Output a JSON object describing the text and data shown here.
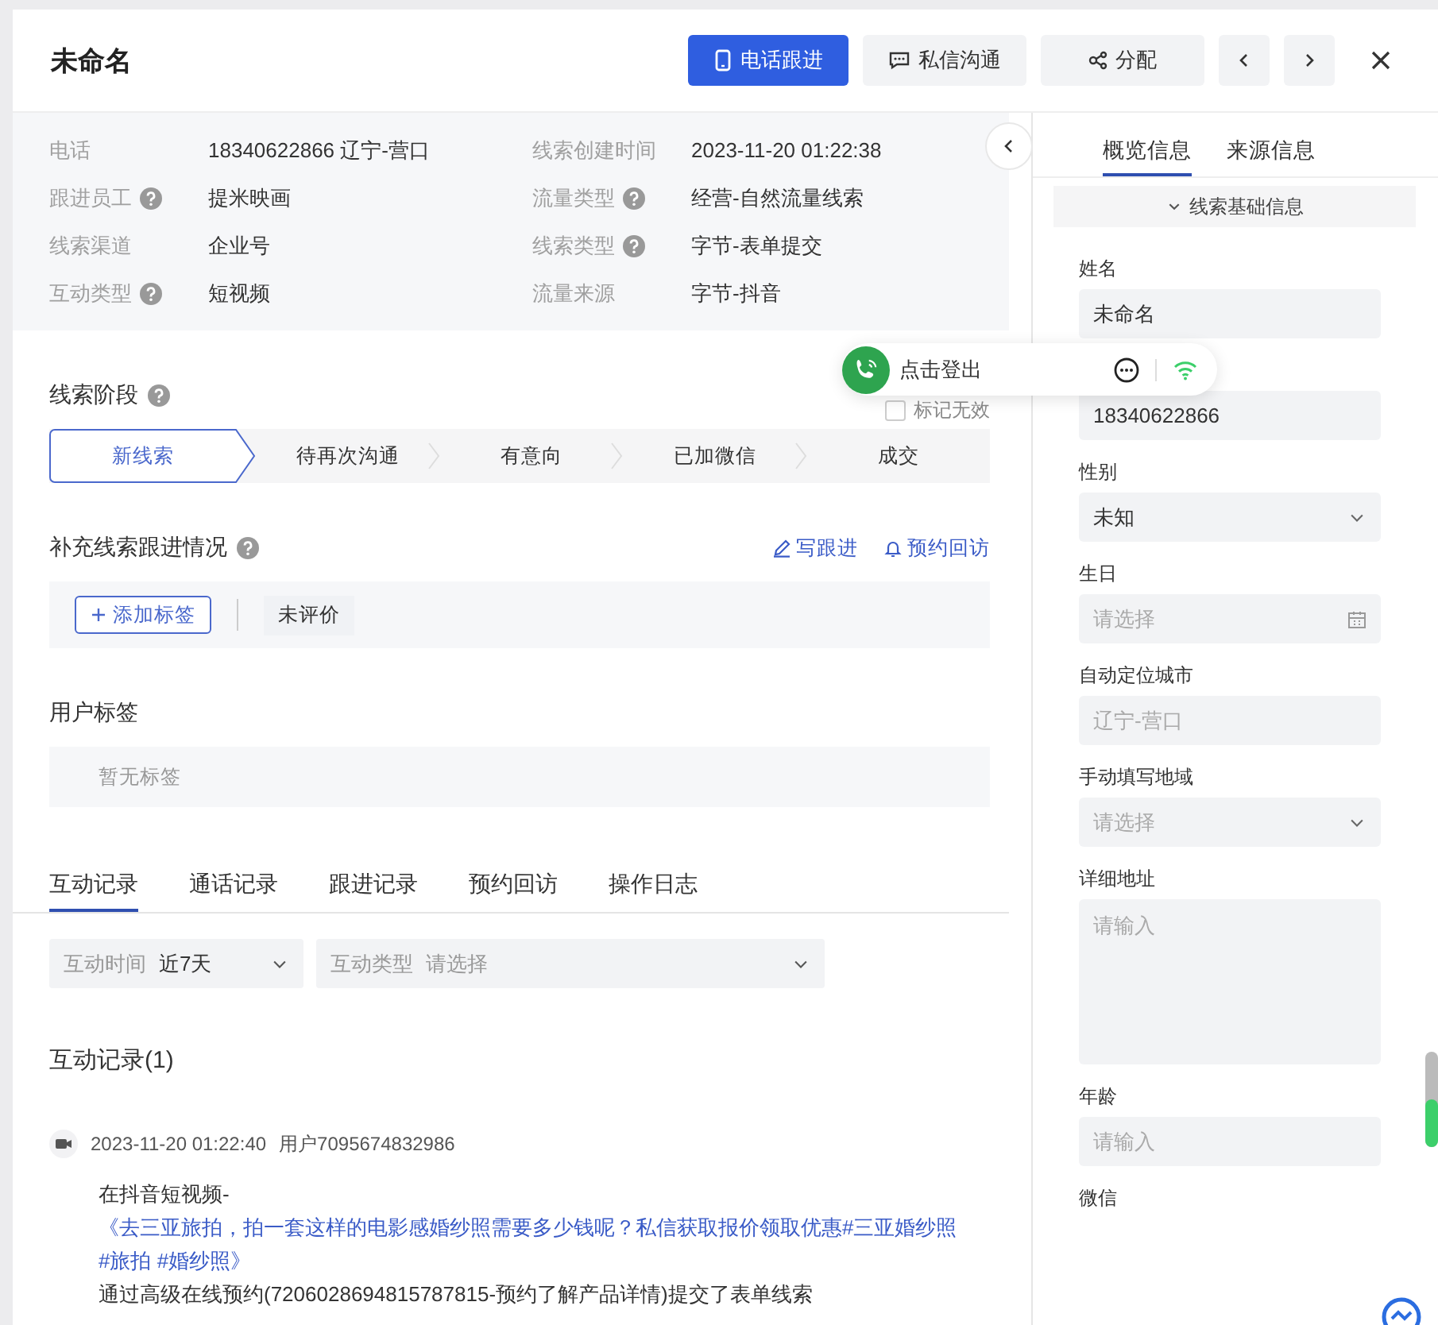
{
  "header": {
    "title": "未命名",
    "buttons": [
      {
        "label": "电话跟进",
        "kind": "call"
      },
      {
        "label": "私信沟通",
        "kind": "chat"
      },
      {
        "label": "分配",
        "kind": "assign"
      }
    ]
  },
  "info": [
    {
      "label": "电话",
      "help": false,
      "value": "18340622866 辽宁-营口"
    },
    {
      "label": "线索创建时间",
      "help": false,
      "value": "2023-11-20 01:22:38"
    },
    {
      "label": "跟进员工",
      "help": true,
      "value": "提米映画"
    },
    {
      "label": "流量类型",
      "help": true,
      "value": "经营-自然流量线索"
    },
    {
      "label": "线索渠道",
      "help": false,
      "value": "企业号"
    },
    {
      "label": "线索类型",
      "help": true,
      "value": "字节-表单提交"
    },
    {
      "label": "互动类型",
      "help": true,
      "value": "短视频"
    },
    {
      "label": "流量来源",
      "help": false,
      "value": "字节-抖音"
    }
  ],
  "stage": {
    "title": "线索阶段",
    "help": true,
    "mark_invalid": {
      "label": "标记无效",
      "checked": false
    },
    "steps": [
      {
        "label": "新线索",
        "selected": true
      },
      {
        "label": "待再次沟通",
        "selected": false
      },
      {
        "label": "有意向",
        "selected": false
      },
      {
        "label": "已加微信",
        "selected": false
      },
      {
        "label": "成交",
        "selected": false
      }
    ]
  },
  "followup": {
    "title": "补充线索跟进情况",
    "help": true,
    "actions": [
      {
        "label": "写跟进",
        "kind": "write"
      },
      {
        "label": "预约回访",
        "kind": "remind"
      }
    ],
    "add_tag": "添加标签",
    "rating": "未评价"
  },
  "user_tags": {
    "title": "用户标签",
    "empty": "暂无标签"
  },
  "record_tabs": [
    {
      "label": "互动记录",
      "selected": true
    },
    {
      "label": "通话记录",
      "selected": false
    },
    {
      "label": "跟进记录",
      "selected": false
    },
    {
      "label": "预约回访",
      "selected": false
    },
    {
      "label": "操作日志",
      "selected": false
    }
  ],
  "filters": [
    {
      "label": "互动时间",
      "value": "近7天"
    },
    {
      "label": "互动类型",
      "placeholder": "请选择"
    }
  ],
  "records": {
    "title": "互动记录(1)",
    "items": [
      {
        "time": "2023-11-20 01:22:40",
        "user": "用户7095674832986",
        "lines": [
          {
            "kind": "plain",
            "text": "在抖音短视频-"
          },
          {
            "kind": "link",
            "text": "《去三亚旅拍，拍一套这样的电影感婚纱照需要多少钱呢？私信获取报价领取优惠#三亚婚纱照 #旅拍 #婚纱照》"
          },
          {
            "kind": "plain",
            "text": "通过高级在线预约(7206028694815787815-预约了解产品详情)提交了表单线索"
          }
        ]
      }
    ]
  },
  "call_widget": {
    "label": "点击登出"
  },
  "side_tabs": [
    {
      "label": "概览信息",
      "selected": true
    },
    {
      "label": "来源信息",
      "selected": false
    }
  ],
  "section": {
    "title": "线索基础信息",
    "expanded": true
  },
  "fields": [
    {
      "label": "姓名",
      "kind": "text",
      "value": "未命名"
    },
    {
      "kind": "text",
      "value": "18340622866"
    },
    {
      "label": "性别",
      "kind": "select",
      "value": "未知"
    },
    {
      "label": "生日",
      "kind": "date",
      "placeholder": "请选择"
    },
    {
      "label": "自动定位城市",
      "kind": "text",
      "placeholder": "辽宁-营口"
    },
    {
      "label": "手动填写地域",
      "kind": "select",
      "placeholder": "请选择"
    },
    {
      "label": "详细地址",
      "kind": "textarea",
      "placeholder": "请输入"
    },
    {
      "label": "年龄",
      "kind": "text",
      "placeholder": "请输入"
    },
    {
      "label": "微信",
      "kind": "label_only"
    }
  ]
}
